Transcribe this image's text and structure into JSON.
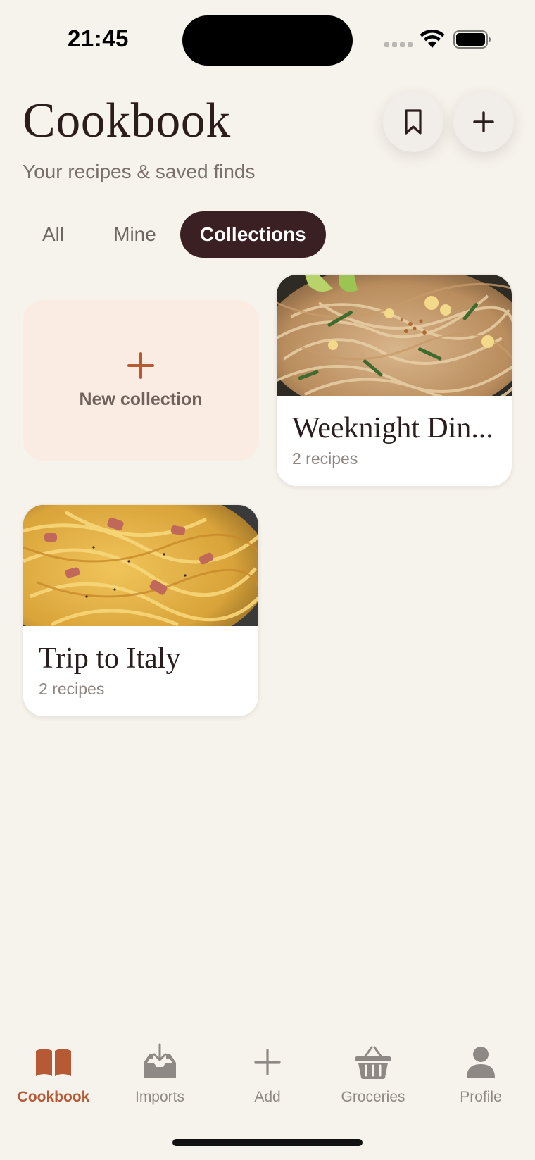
{
  "status_bar": {
    "time": "21:45"
  },
  "header": {
    "title": "Cookbook",
    "subtitle": "Your recipes & saved finds"
  },
  "header_actions": [
    {
      "icon": "bookmark-icon"
    },
    {
      "icon": "plus-icon"
    }
  ],
  "tabs": [
    {
      "label": "All",
      "active": false
    },
    {
      "label": "Mine",
      "active": false
    },
    {
      "label": "Collections",
      "active": true
    }
  ],
  "new_collection": {
    "label": "New collection"
  },
  "collections": [
    {
      "name": "Weeknight Din...",
      "count": "2 recipes",
      "image": "pad-thai-noodles"
    },
    {
      "name": "Trip to Italy",
      "count": "2 recipes",
      "image": "carbonara-pasta"
    }
  ],
  "tab_bar": [
    {
      "label": "Cookbook",
      "icon": "book-icon",
      "active": true
    },
    {
      "label": "Imports",
      "icon": "tray-download-icon",
      "active": false
    },
    {
      "label": "Add",
      "icon": "plus-icon",
      "active": false
    },
    {
      "label": "Groceries",
      "icon": "basket-icon",
      "active": false
    },
    {
      "label": "Profile",
      "icon": "person-icon",
      "active": false
    }
  ],
  "colors": {
    "background": "#f6f2ec",
    "accent": "#b55a35",
    "active_tab": "#3b2023",
    "new_collection_bg": "#fbece3"
  }
}
